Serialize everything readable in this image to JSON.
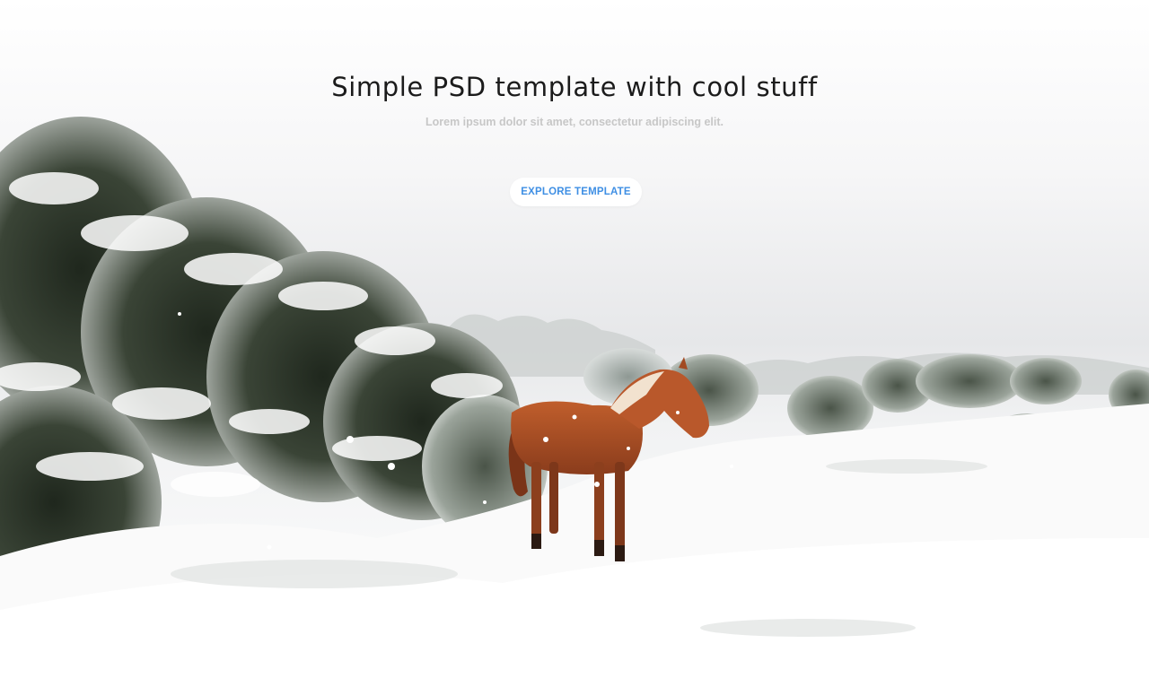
{
  "hero": {
    "title": "Simple PSD template with cool stuff",
    "subtitle": "Lorem ipsum dolor sit amet, consectetur adipiscing elit.",
    "cta_label": "EXPLORE TEMPLATE"
  },
  "colors": {
    "title": "#1b1b1b",
    "subtitle": "#c7c7c7",
    "cta_text": "#3f8fe4",
    "cta_bg": "#ffffff",
    "snow": "#ffffff",
    "horse": "#b4552a",
    "shrub": "#2a3325"
  },
  "image": {
    "subject": "horse-in-snow-photo"
  }
}
